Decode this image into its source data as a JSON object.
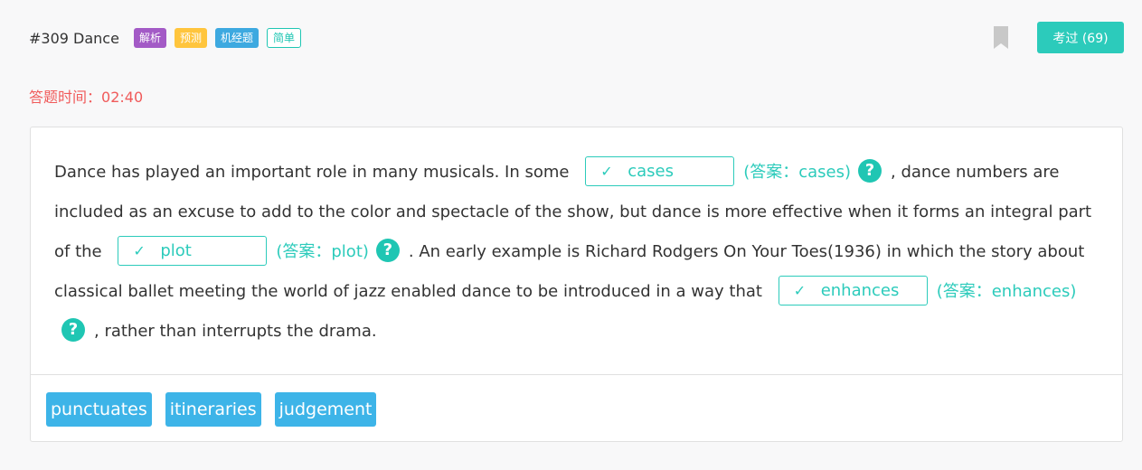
{
  "header": {
    "title": "#309 Dance",
    "tags": [
      "解析",
      "预测",
      "机经题",
      "简单"
    ],
    "exam_button": "考过 (69)"
  },
  "timer": {
    "label": "答题时间：",
    "value": "02:40"
  },
  "passage": {
    "seg1": "Dance has played an important role in many musicals. In some",
    "seg2": ", dance numbers are included as an excuse to add to the color and spectacle of the show, but dance is more effective when it forms an integral part of the",
    "seg3": ". An early example is Richard Rodgers On Your Toes(1936) in which the story about classical ballet meeting the world of jazz enabled dance to be introduced in a way that",
    "seg4": ", rather than interrupts the drama.",
    "blanks": [
      {
        "value": "cases",
        "answer_label": "(答案：cases)"
      },
      {
        "value": "plot",
        "answer_label": "(答案：plot)"
      },
      {
        "value": "enhances",
        "answer_label": "(答案：enhances)"
      }
    ],
    "check_glyph": "✓",
    "help_glyph": "?"
  },
  "options": [
    "punctuates",
    "itineraries",
    "judgement"
  ],
  "colors": {
    "accent": "#2ccbbb",
    "timer_red": "#f05a5a",
    "option_blue": "#3db4e8",
    "tag_purple": "#a35ac6",
    "tag_yellow": "#ffc53d",
    "tag_blue": "#3da9e0"
  },
  "icons": {
    "bookmark": "bookmark-icon",
    "check": "check-icon",
    "help": "help-circle-icon"
  }
}
